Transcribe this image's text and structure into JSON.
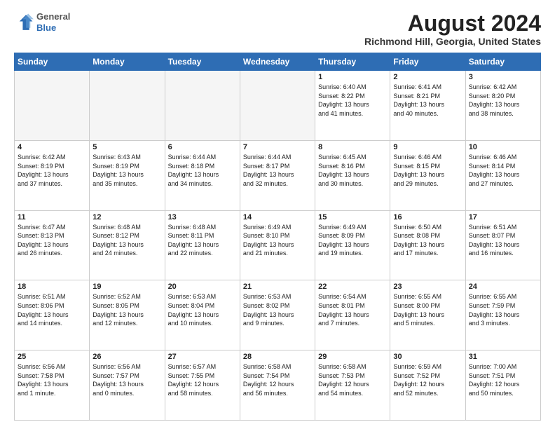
{
  "header": {
    "logo_general": "General",
    "logo_blue": "Blue",
    "month_title": "August 2024",
    "location": "Richmond Hill, Georgia, United States"
  },
  "days_of_week": [
    "Sunday",
    "Monday",
    "Tuesday",
    "Wednesday",
    "Thursday",
    "Friday",
    "Saturday"
  ],
  "weeks": [
    [
      {
        "day": "",
        "info": ""
      },
      {
        "day": "",
        "info": ""
      },
      {
        "day": "",
        "info": ""
      },
      {
        "day": "",
        "info": ""
      },
      {
        "day": "1",
        "info": "Sunrise: 6:40 AM\nSunset: 8:22 PM\nDaylight: 13 hours\nand 41 minutes."
      },
      {
        "day": "2",
        "info": "Sunrise: 6:41 AM\nSunset: 8:21 PM\nDaylight: 13 hours\nand 40 minutes."
      },
      {
        "day": "3",
        "info": "Sunrise: 6:42 AM\nSunset: 8:20 PM\nDaylight: 13 hours\nand 38 minutes."
      }
    ],
    [
      {
        "day": "4",
        "info": "Sunrise: 6:42 AM\nSunset: 8:19 PM\nDaylight: 13 hours\nand 37 minutes."
      },
      {
        "day": "5",
        "info": "Sunrise: 6:43 AM\nSunset: 8:19 PM\nDaylight: 13 hours\nand 35 minutes."
      },
      {
        "day": "6",
        "info": "Sunrise: 6:44 AM\nSunset: 8:18 PM\nDaylight: 13 hours\nand 34 minutes."
      },
      {
        "day": "7",
        "info": "Sunrise: 6:44 AM\nSunset: 8:17 PM\nDaylight: 13 hours\nand 32 minutes."
      },
      {
        "day": "8",
        "info": "Sunrise: 6:45 AM\nSunset: 8:16 PM\nDaylight: 13 hours\nand 30 minutes."
      },
      {
        "day": "9",
        "info": "Sunrise: 6:46 AM\nSunset: 8:15 PM\nDaylight: 13 hours\nand 29 minutes."
      },
      {
        "day": "10",
        "info": "Sunrise: 6:46 AM\nSunset: 8:14 PM\nDaylight: 13 hours\nand 27 minutes."
      }
    ],
    [
      {
        "day": "11",
        "info": "Sunrise: 6:47 AM\nSunset: 8:13 PM\nDaylight: 13 hours\nand 26 minutes."
      },
      {
        "day": "12",
        "info": "Sunrise: 6:48 AM\nSunset: 8:12 PM\nDaylight: 13 hours\nand 24 minutes."
      },
      {
        "day": "13",
        "info": "Sunrise: 6:48 AM\nSunset: 8:11 PM\nDaylight: 13 hours\nand 22 minutes."
      },
      {
        "day": "14",
        "info": "Sunrise: 6:49 AM\nSunset: 8:10 PM\nDaylight: 13 hours\nand 21 minutes."
      },
      {
        "day": "15",
        "info": "Sunrise: 6:49 AM\nSunset: 8:09 PM\nDaylight: 13 hours\nand 19 minutes."
      },
      {
        "day": "16",
        "info": "Sunrise: 6:50 AM\nSunset: 8:08 PM\nDaylight: 13 hours\nand 17 minutes."
      },
      {
        "day": "17",
        "info": "Sunrise: 6:51 AM\nSunset: 8:07 PM\nDaylight: 13 hours\nand 16 minutes."
      }
    ],
    [
      {
        "day": "18",
        "info": "Sunrise: 6:51 AM\nSunset: 8:06 PM\nDaylight: 13 hours\nand 14 minutes."
      },
      {
        "day": "19",
        "info": "Sunrise: 6:52 AM\nSunset: 8:05 PM\nDaylight: 13 hours\nand 12 minutes."
      },
      {
        "day": "20",
        "info": "Sunrise: 6:53 AM\nSunset: 8:04 PM\nDaylight: 13 hours\nand 10 minutes."
      },
      {
        "day": "21",
        "info": "Sunrise: 6:53 AM\nSunset: 8:02 PM\nDaylight: 13 hours\nand 9 minutes."
      },
      {
        "day": "22",
        "info": "Sunrise: 6:54 AM\nSunset: 8:01 PM\nDaylight: 13 hours\nand 7 minutes."
      },
      {
        "day": "23",
        "info": "Sunrise: 6:55 AM\nSunset: 8:00 PM\nDaylight: 13 hours\nand 5 minutes."
      },
      {
        "day": "24",
        "info": "Sunrise: 6:55 AM\nSunset: 7:59 PM\nDaylight: 13 hours\nand 3 minutes."
      }
    ],
    [
      {
        "day": "25",
        "info": "Sunrise: 6:56 AM\nSunset: 7:58 PM\nDaylight: 13 hours\nand 1 minute."
      },
      {
        "day": "26",
        "info": "Sunrise: 6:56 AM\nSunset: 7:57 PM\nDaylight: 13 hours\nand 0 minutes."
      },
      {
        "day": "27",
        "info": "Sunrise: 6:57 AM\nSunset: 7:55 PM\nDaylight: 12 hours\nand 58 minutes."
      },
      {
        "day": "28",
        "info": "Sunrise: 6:58 AM\nSunset: 7:54 PM\nDaylight: 12 hours\nand 56 minutes."
      },
      {
        "day": "29",
        "info": "Sunrise: 6:58 AM\nSunset: 7:53 PM\nDaylight: 12 hours\nand 54 minutes."
      },
      {
        "day": "30",
        "info": "Sunrise: 6:59 AM\nSunset: 7:52 PM\nDaylight: 12 hours\nand 52 minutes."
      },
      {
        "day": "31",
        "info": "Sunrise: 7:00 AM\nSunset: 7:51 PM\nDaylight: 12 hours\nand 50 minutes."
      }
    ]
  ]
}
